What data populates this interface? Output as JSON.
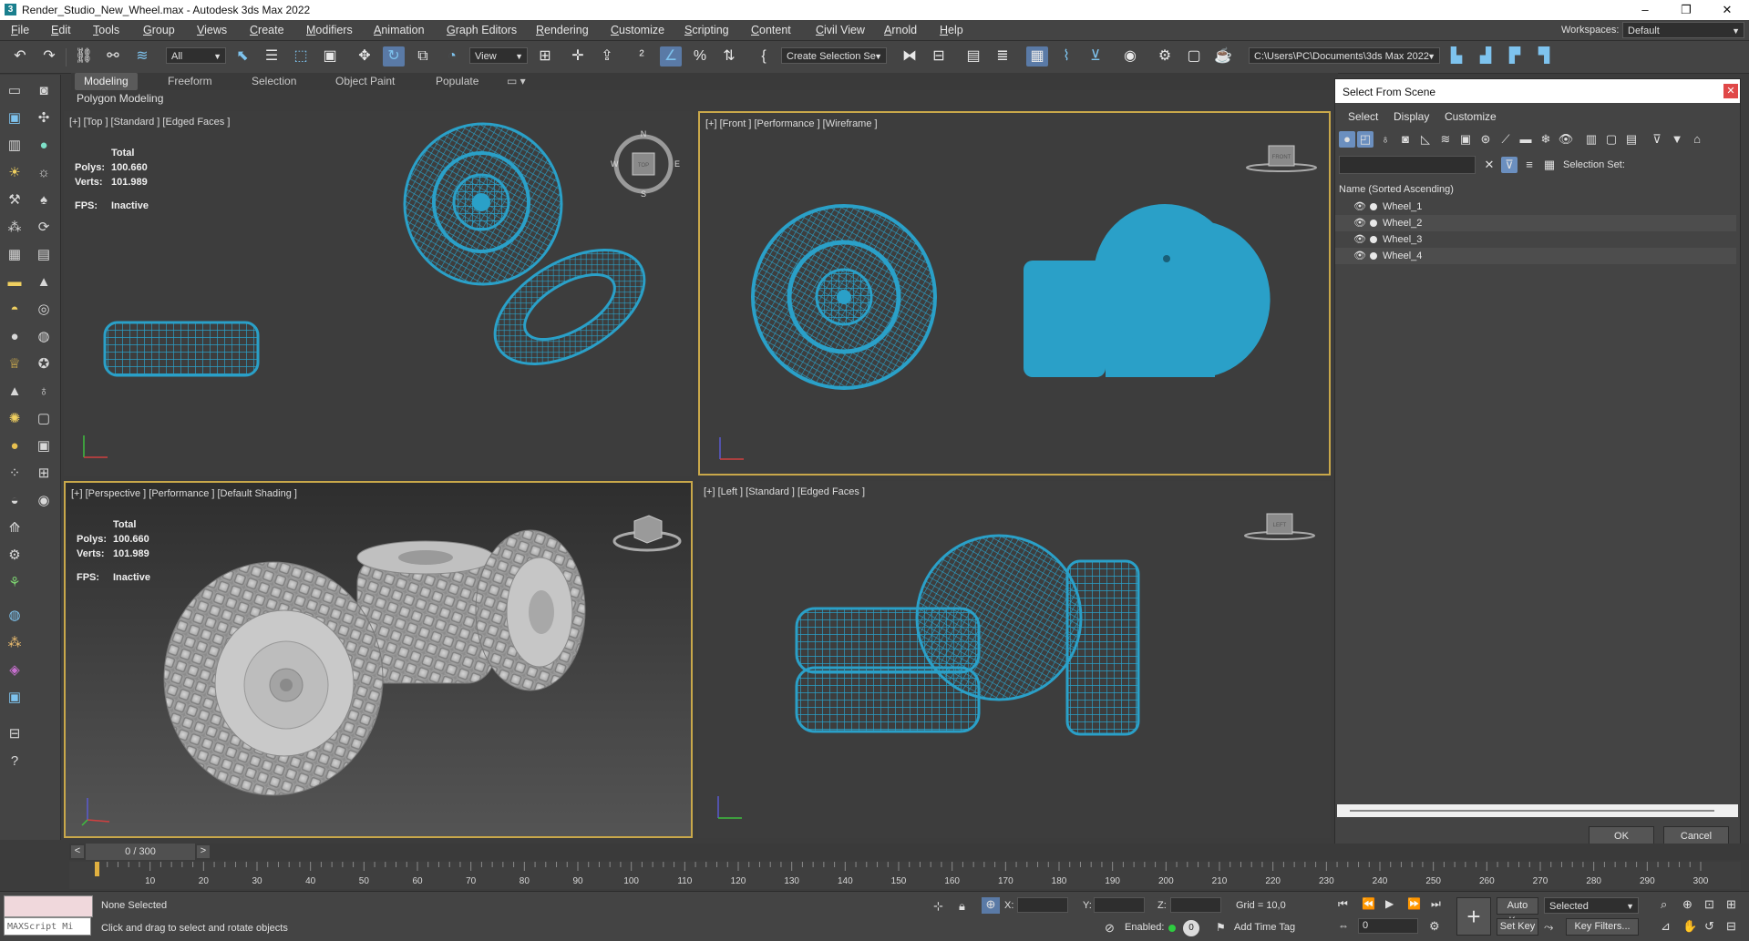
{
  "window": {
    "title": "Render_Studio_New_Wheel.max - Autodesk 3ds Max 2022",
    "controls": {
      "minimize": "–",
      "maximize": "❐",
      "close": "✕"
    }
  },
  "menu": [
    "File",
    "Edit",
    "Tools",
    "Group",
    "Views",
    "Create",
    "Modifiers",
    "Animation",
    "Graph Editors",
    "Rendering",
    "Customize",
    "Scripting",
    "Content",
    "Civil View",
    "Arnold",
    "Help"
  ],
  "workspace": {
    "label": "Workspaces:",
    "value": "Default"
  },
  "toolbar": {
    "filter_value": "All",
    "view_value": "View",
    "selection_set": "Create Selection Se",
    "project_path": "C:\\Users\\PC\\Documents\\3ds Max 2022"
  },
  "ribbon": {
    "tabs": [
      "Modeling",
      "Freeform",
      "Selection",
      "Object Paint",
      "Populate"
    ],
    "active_tab": "Modeling",
    "sub_label": "Polygon Modeling"
  },
  "viewports": {
    "top": {
      "label": "[+] [Top ] [Standard ] [Edged Faces ]"
    },
    "front": {
      "label": "[+] [Front ] [Performance ] [Wireframe ]",
      "cube": "FRONT"
    },
    "perspective": {
      "label": "[+] [Perspective ] [Performance ] [Default Shading ]"
    },
    "left": {
      "label": "[+] [Left ] [Standard ] [Edged Faces ]",
      "cube": "LEFT"
    },
    "stats": {
      "total_label": "Total",
      "polys_label": "Polys:",
      "polys": "100.660",
      "verts_label": "Verts:",
      "verts": "101.989",
      "fps_label": "FPS:",
      "fps": "Inactive"
    },
    "compass": {
      "n": "N",
      "s": "S",
      "e": "E",
      "w": "W",
      "cube": "TOP"
    }
  },
  "scene_panel": {
    "title": "Select From Scene",
    "menu": [
      "Select",
      "Display",
      "Customize"
    ],
    "selection_set_label": "Selection Set:",
    "column_header": "Name (Sorted Ascending)",
    "items": [
      "Wheel_1",
      "Wheel_2",
      "Wheel_3",
      "Wheel_4"
    ],
    "ok": "OK",
    "cancel": "Cancel"
  },
  "timeline": {
    "frame_display": "0 / 300",
    "ticks": [
      "10",
      "20",
      "30",
      "40",
      "50",
      "60",
      "70",
      "80",
      "90",
      "100",
      "110",
      "120",
      "130",
      "140",
      "150",
      "160",
      "170",
      "180",
      "190",
      "200",
      "210",
      "220",
      "230",
      "240",
      "250",
      "260",
      "270",
      "280",
      "290",
      "300"
    ]
  },
  "status": {
    "maxscript": "MAXScript Mi",
    "selection": "None Selected",
    "prompt": "Click and drag to select and rotate objects",
    "x_label": "X:",
    "y_label": "Y:",
    "z_label": "Z:",
    "grid": "Grid = 10,0",
    "enabled_label": "Enabled:",
    "enabled_value": "0",
    "add_time_tag": "Add Time Tag",
    "auto_key": "Auto Key",
    "selected_value": "Selected",
    "set_key": "Set Key",
    "key_filters": "Key Filters...",
    "frame_field": "0"
  },
  "colors": {
    "wire": "#2aa0c8",
    "shaded": "#b5b5b5",
    "active_border": "#c9a84a"
  }
}
